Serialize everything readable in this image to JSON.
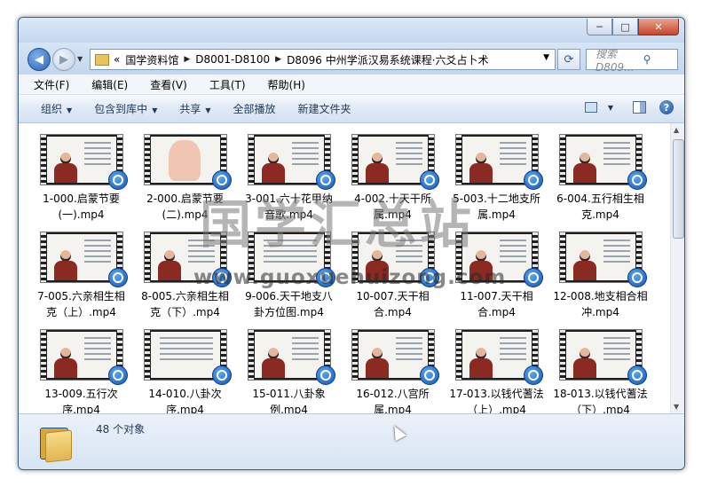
{
  "window": {
    "controls": {
      "minimize": "─",
      "maximize": "□",
      "close": "✕"
    }
  },
  "nav": {
    "breadcrumb_prefix": "«",
    "breadcrumbs": [
      "国学资料馆",
      "D8001-D8100",
      "D8096 中州学派汉易系统课程·六爻占卜术"
    ],
    "search_placeholder": "搜索 D809..."
  },
  "menu": [
    "文件(F)",
    "编辑(E)",
    "查看(V)",
    "工具(T)",
    "帮助(H)"
  ],
  "toolbar": {
    "organize": "组织",
    "include_library": "包含到库中",
    "share": "共享",
    "play_all": "全部播放",
    "new_folder": "新建文件夹"
  },
  "files": [
    {
      "name": "1-000.启蒙节要(一).mp4",
      "kind": "person"
    },
    {
      "name": "2-000.启蒙节要(二).mp4",
      "kind": "hand"
    },
    {
      "name": "3-001.六十花甲纳音歌.mp4",
      "kind": "person"
    },
    {
      "name": "4-002.十天干所属.mp4",
      "kind": "person"
    },
    {
      "name": "5-003.十二地支所属.mp4",
      "kind": "person"
    },
    {
      "name": "6-004.五行相生相克.mp4",
      "kind": "person"
    },
    {
      "name": "7-005.六亲相生相克（上）.mp4",
      "kind": "person"
    },
    {
      "name": "8-005.六亲相生相克（下）.mp4",
      "kind": "person"
    },
    {
      "name": "9-006.天干地支八卦方位图.mp4",
      "kind": "chart"
    },
    {
      "name": "10-007.天干相合.mp4",
      "kind": "person"
    },
    {
      "name": "11-007.天干相合.mp4",
      "kind": "person"
    },
    {
      "name": "12-008.地支相合相冲.mp4",
      "kind": "person"
    },
    {
      "name": "13-009.五行次序.mp4",
      "kind": "person"
    },
    {
      "name": "14-010.八卦次序.mp4",
      "kind": "chart"
    },
    {
      "name": "15-011.八卦象例.mp4",
      "kind": "person"
    },
    {
      "name": "16-012.八宫所属.mp4",
      "kind": "person"
    },
    {
      "name": "17-013.以钱代蓍法（上）.mp4",
      "kind": "person"
    },
    {
      "name": "18-013.以钱代蓍法（下）.mp4",
      "kind": "person"
    }
  ],
  "watermark": {
    "title": "国学汇总站",
    "url": "www.guoxuehuizong.com"
  },
  "status": {
    "count": "48 个对象"
  }
}
